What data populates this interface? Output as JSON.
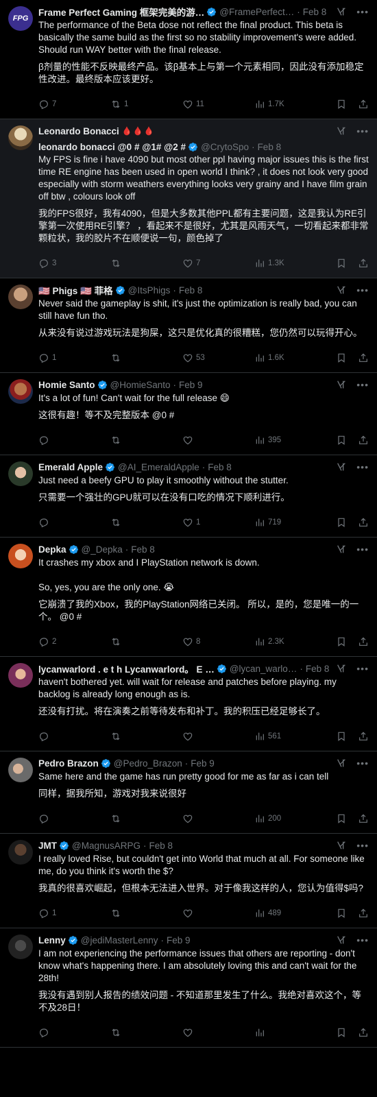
{
  "colors": {
    "accent": "#1d9bf0",
    "muted": "#71767b",
    "text": "#e7e9ea",
    "background": "#000000",
    "divider": "#2f3336"
  },
  "tweets": [
    {
      "name": "Frame Perfect Gaming 框架完美的游…",
      "handle": "@FramePerfect…",
      "date": "Feb 8",
      "avatar_label": "FPG",
      "text": "The performance of the Beta dose not reflect the final product. This beta is basically the same build as the first so no stability improvement's were added. Should run WAY better with the final release.",
      "translation": "β剂量的性能不反映最终产品。该β基本上与第一个元素相同，因此没有添加稳定性改进。最终版本应该更好。",
      "replies": "7",
      "retweets": "1",
      "likes": "11",
      "views": "1.7K"
    },
    {
      "name": "Leonardo Bonacci",
      "name_extra": "🩸🩸🩸",
      "subname": "leonardo bonacci @0 # @1# @2 #",
      "handle": "@CrytoSpo",
      "date": "Feb 8",
      "text": "My FPS is fine i have 4090 but most other ppl having major issues this is the first time RE engine has been used in open world I think? , it does not look very good especially with storm weathers everything looks very grainy and I have film grain off btw , colours look off",
      "translation": "我的FPS很好，我有4090，但是大多数其他PPL都有主要问题，这是我认为RE引擎第一次使用RE引擎？ ，看起来不是很好，尤其是风雨天气，一切看起来都非常颗粒状，我的胶片不在顺便说一句，颜色掉了",
      "replies": "3",
      "retweets": "",
      "likes": "7",
      "views": "1.3K"
    },
    {
      "name": "🇺🇸 Phigs 🇺🇸 菲格",
      "handle": "@ItsPhigs",
      "date": "Feb 8",
      "text": "Never said the gameplay is shit, it's just the optimization is really bad, you can still have fun tho.",
      "translation": "从来没有说过游戏玩法是狗屎，这只是优化真的很糟糕，您仍然可以玩得开心。",
      "replies": "1",
      "retweets": "",
      "likes": "53",
      "views": "1.6K"
    },
    {
      "name": "Homie Santo",
      "handle": "@HomieSanto",
      "date": "Feb 9",
      "text": "It's a lot of fun! Can't wait for the full release 😄",
      "translation": "这很有趣！等不及完整版本 @0 #",
      "replies": "",
      "retweets": "",
      "likes": "",
      "views": "395"
    },
    {
      "name": "Emerald Apple",
      "handle": "@AI_EmeraldApple",
      "date": "Feb 8",
      "text": "Just need a beefy GPU to play it smoothly without the stutter.",
      "translation": "只需要一个强壮的GPU就可以在没有口吃的情况下顺利进行。",
      "replies": "",
      "retweets": "",
      "likes": "1",
      "views": "719"
    },
    {
      "name": "Depka",
      "handle": "@_Depka",
      "date": "Feb 8",
      "text": "It crashes my xbox and I PlayStation network is down.\n\nSo, yes, you are the only one. 😭",
      "translation": "它崩溃了我的Xbox，我的PlayStation网络已关闭。 所以，是的，您是唯一的一个。 @0 #",
      "replies": "2",
      "retweets": "",
      "likes": "8",
      "views": "2.3K"
    },
    {
      "name": "lycanwarlord . e t h Lycanwarlord。 E …",
      "handle": "@lycan_warlo…",
      "date": "Feb 8",
      "text": "haven't bothered yet. will wait for release and patches before playing. my backlog is already long enough as is.",
      "translation": "还没有打扰。将在演奏之前等待发布和补丁。我的积压已经足够长了。",
      "replies": "",
      "retweets": "",
      "likes": "",
      "views": "561"
    },
    {
      "name": "Pedro Brazon",
      "handle": "@Pedro_Brazon",
      "date": "Feb 9",
      "text": "Same here and the game has run pretty good for me as far as i can tell",
      "translation": "同样，据我所知，游戏对我来说很好",
      "replies": "",
      "retweets": "",
      "likes": "",
      "views": "200"
    },
    {
      "name": "JMT",
      "handle": "@MagnusARPG",
      "date": "Feb 8",
      "text": "I really loved Rise, but couldn't get into World that much at all. For someone like me, do you think it's worth the $?",
      "translation": "我真的很喜欢崛起，但根本无法进入世界。对于像我这样的人，您认为值得$吗?",
      "replies": "1",
      "retweets": "",
      "likes": "",
      "views": "489"
    },
    {
      "name": "Lenny",
      "handle": "@jediMasterLenny",
      "date": "Feb 9",
      "text": "I am not experiencing the performance issues that others are reporting - don't know what's happening there. I am absolutely loving this and can't wait for the 28th!",
      "translation": "我没有遇到别人报告的绩效问题 - 不知道那里发生了什么。我绝对喜欢这个，等不及28日！",
      "replies": "",
      "retweets": "",
      "likes": "",
      "views": ""
    }
  ]
}
